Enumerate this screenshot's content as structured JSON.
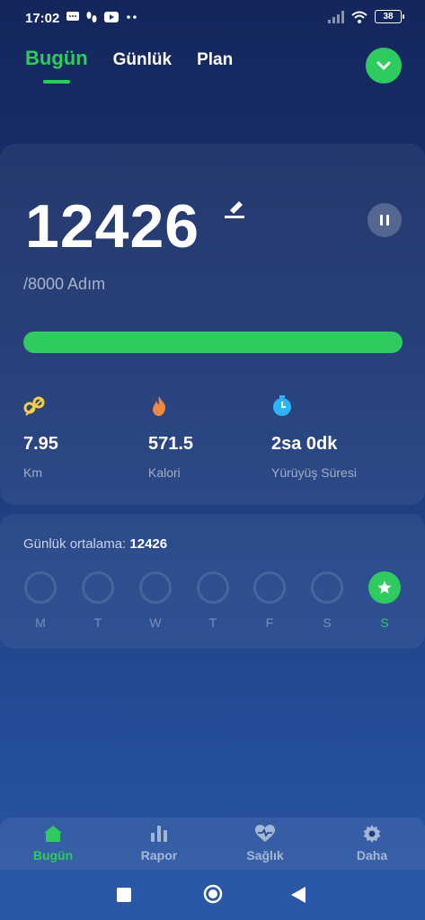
{
  "status_bar": {
    "time": "17:02",
    "battery": "38"
  },
  "tabs": [
    {
      "label": "Bugün",
      "active": true
    },
    {
      "label": "Günlük",
      "active": false
    },
    {
      "label": "Plan",
      "active": false
    }
  ],
  "today": {
    "steps": "12426",
    "goal_text": "/8000 Adım",
    "progress": 1.0
  },
  "stats": [
    {
      "value": "7.95",
      "label": "Km",
      "icon": "distance-pin-icon"
    },
    {
      "value": "571.5",
      "label": "Kalori",
      "icon": "flame-icon"
    },
    {
      "value": "2sa 0dk",
      "label": "Yürüyüş Süresi",
      "icon": "stopwatch-icon"
    }
  ],
  "weekly": {
    "avg_label": "Günlük ortalama:",
    "avg_value": "12426",
    "days": [
      {
        "letter": "M",
        "done": false
      },
      {
        "letter": "T",
        "done": false
      },
      {
        "letter": "W",
        "done": false
      },
      {
        "letter": "T",
        "done": false
      },
      {
        "letter": "F",
        "done": false
      },
      {
        "letter": "S",
        "done": false
      },
      {
        "letter": "S",
        "done": true
      }
    ]
  },
  "bottom_nav": [
    {
      "label": "Bugün",
      "icon": "home-icon",
      "active": true
    },
    {
      "label": "Rapor",
      "icon": "bar-chart-icon",
      "active": false
    },
    {
      "label": "Sağlık",
      "icon": "heart-pulse-icon",
      "active": false
    },
    {
      "label": "Daha",
      "icon": "gear-icon",
      "active": false
    }
  ],
  "colors": {
    "accent": "#2ecc5f",
    "background": "#1b3470"
  }
}
